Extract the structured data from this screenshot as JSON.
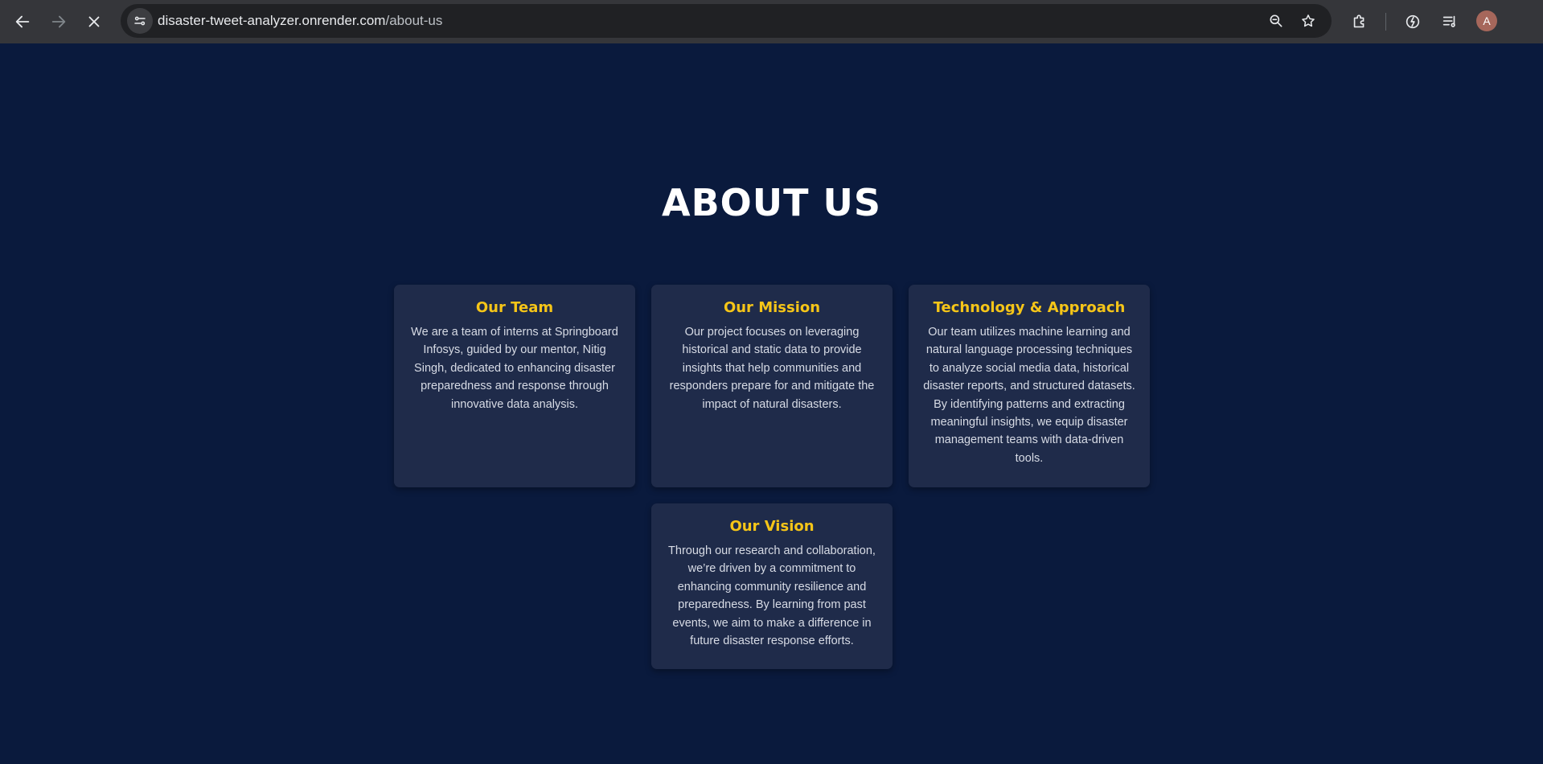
{
  "browser": {
    "url_domain": "disaster-tweet-analyzer.onrender.com",
    "url_path": "/about-us",
    "profile_initial": "A",
    "icons": {
      "back": "arrow-left-icon",
      "forward": "arrow-right-icon",
      "stop": "close-icon",
      "site_info": "tune-icon",
      "zoom": "zoom-icon",
      "bookmark": "star-icon",
      "extensions": "puzzle-icon",
      "performance": "leaf-speed-icon",
      "media": "media-queue-icon"
    }
  },
  "page": {
    "title": "ABOUT US",
    "colors": {
      "background": "#0a1a3d",
      "card": "#1f2b4a",
      "accent": "#f5c518"
    },
    "cards": [
      {
        "title": "Our Team",
        "text": "We are a team of interns at Springboard Infosys, guided by our mentor, Nitig Singh, dedicated to enhancing disaster preparedness and response through innovative data analysis."
      },
      {
        "title": "Our Mission",
        "text": "Our project focuses on leveraging historical and static data to provide insights that help communities and responders prepare for and mitigate the impact of natural disasters."
      },
      {
        "title": "Technology & Approach",
        "text": "Our team utilizes machine learning and natural language processing techniques to analyze social media data, historical disaster reports, and structured datasets. By identifying patterns and extracting meaningful insights, we equip disaster management teams with data-driven tools."
      },
      {
        "title": "Our Vision",
        "text": "Through our research and collaboration, we’re driven by a commitment to enhancing community resilience and preparedness. By learning from past events, we aim to make a difference in future disaster response efforts."
      }
    ]
  }
}
